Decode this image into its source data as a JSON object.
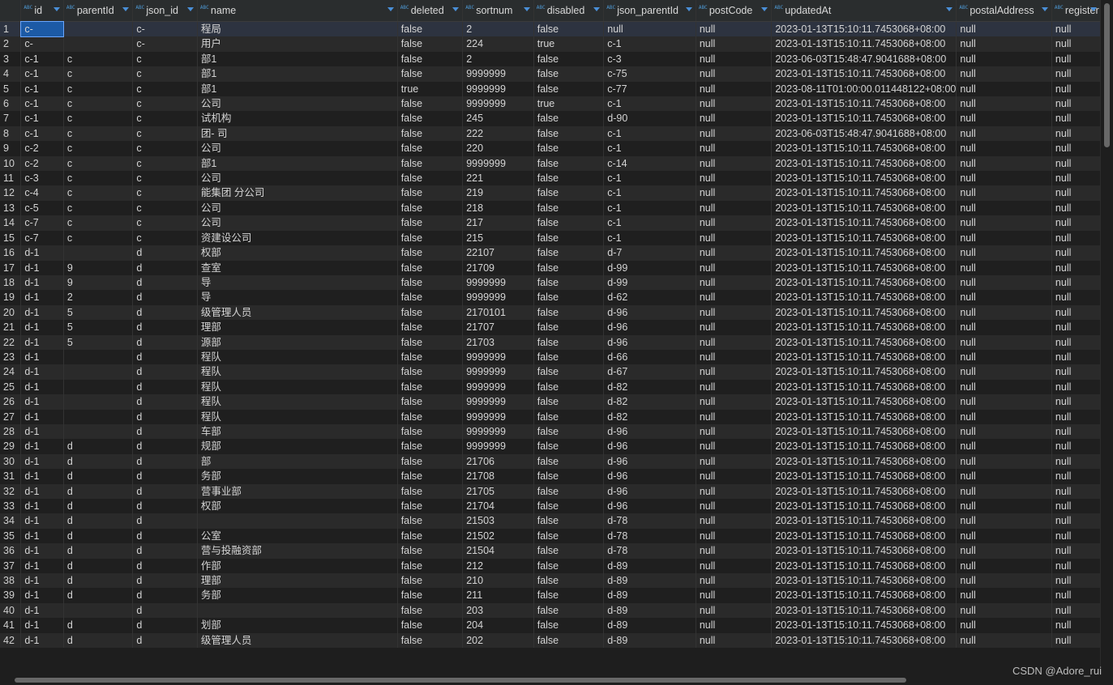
{
  "columns": [
    {
      "label": "id",
      "width": 53
    },
    {
      "label": "parentId",
      "width": 86
    },
    {
      "label": "json_id",
      "width": 80
    },
    {
      "label": "name",
      "width": 250
    },
    {
      "label": "deleted",
      "width": 81
    },
    {
      "label": "sortnum",
      "width": 88
    },
    {
      "label": "disabled",
      "width": 87
    },
    {
      "label": "json_parentId",
      "width": 114
    },
    {
      "label": "postCode",
      "width": 94
    },
    {
      "label": "updatedAt",
      "width": 222
    },
    {
      "label": "postalAddress",
      "width": 118
    },
    {
      "label": "register",
      "width": 60
    }
  ],
  "type_code_label": "ABC",
  "rows": [
    [
      "1",
      "c-",
      "",
      "c-",
      "程局",
      "false",
      "2",
      "false",
      "null",
      "null",
      "2023-01-13T15:10:11.7453068+08:00",
      "null",
      "null"
    ],
    [
      "2",
      "c-",
      "",
      "c-",
      "用户",
      "false",
      "224",
      "true",
      "c-1",
      "null",
      "2023-01-13T15:10:11.7453068+08:00",
      "null",
      "null"
    ],
    [
      "3",
      "c-1",
      "c",
      "c",
      "部1",
      "false",
      "2",
      "false",
      "c-3",
      "null",
      "2023-06-03T15:48:47.9041688+08:00",
      "null",
      "null"
    ],
    [
      "4",
      "c-1",
      "c",
      "c",
      "部1",
      "false",
      "9999999",
      "false",
      "c-75",
      "null",
      "2023-01-13T15:10:11.7453068+08:00",
      "null",
      "null"
    ],
    [
      "5",
      "c-1",
      "c",
      "c",
      "部1",
      "true",
      "9999999",
      "false",
      "c-77",
      "null",
      "2023-08-11T01:00:00.011448122+08:00",
      "null",
      "null"
    ],
    [
      "6",
      "c-1",
      "c",
      "c",
      "公司",
      "false",
      "9999999",
      "true",
      "c-1",
      "null",
      "2023-01-13T15:10:11.7453068+08:00",
      "null",
      "null"
    ],
    [
      "7",
      "c-1",
      "c",
      "c",
      "试机构",
      "false",
      "245",
      "false",
      "d-90",
      "null",
      "2023-01-13T15:10:11.7453068+08:00",
      "null",
      "null"
    ],
    [
      "8",
      "c-1",
      "c",
      "c",
      "团-                  司",
      "false",
      "222",
      "false",
      "c-1",
      "null",
      "2023-06-03T15:48:47.9041688+08:00",
      "null",
      "null"
    ],
    [
      "9",
      "c-2",
      "c",
      "c",
      "公司",
      "false",
      "220",
      "false",
      "c-1",
      "null",
      "2023-01-13T15:10:11.7453068+08:00",
      "null",
      "null"
    ],
    [
      "10",
      "c-2",
      "c",
      "c",
      "部1",
      "false",
      "9999999",
      "false",
      "c-14",
      "null",
      "2023-01-13T15:10:11.7453068+08:00",
      "null",
      "null"
    ],
    [
      "11",
      "c-3",
      "c",
      "c",
      "公司",
      "false",
      "221",
      "false",
      "c-1",
      "null",
      "2023-01-13T15:10:11.7453068+08:00",
      "null",
      "null"
    ],
    [
      "12",
      "c-4",
      "c",
      "c",
      "能集团                  分公司",
      "false",
      "219",
      "false",
      "c-1",
      "null",
      "2023-01-13T15:10:11.7453068+08:00",
      "null",
      "null"
    ],
    [
      "13",
      "c-5",
      "c",
      "c",
      "公司",
      "false",
      "218",
      "false",
      "c-1",
      "null",
      "2023-01-13T15:10:11.7453068+08:00",
      "null",
      "null"
    ],
    [
      "14",
      "c-7",
      "c",
      "c",
      "公司",
      "false",
      "217",
      "false",
      "c-1",
      "null",
      "2023-01-13T15:10:11.7453068+08:00",
      "null",
      "null"
    ],
    [
      "15",
      "c-7",
      "c",
      "c",
      "资建设公司",
      "false",
      "215",
      "false",
      "c-1",
      "null",
      "2023-01-13T15:10:11.7453068+08:00",
      "null",
      "null"
    ],
    [
      "16",
      "d-1",
      "",
      "d",
      "权部",
      "false",
      "22107",
      "false",
      "d-7",
      "null",
      "2023-01-13T15:10:11.7453068+08:00",
      "null",
      "null"
    ],
    [
      "17",
      "d-1",
      "9",
      "d",
      "查室",
      "false",
      "21709",
      "false",
      "d-99",
      "null",
      "2023-01-13T15:10:11.7453068+08:00",
      "null",
      "null"
    ],
    [
      "18",
      "d-1",
      "9",
      "d",
      "导",
      "false",
      "9999999",
      "false",
      "d-99",
      "null",
      "2023-01-13T15:10:11.7453068+08:00",
      "null",
      "null"
    ],
    [
      "19",
      "d-1",
      "2",
      "d",
      "导",
      "false",
      "9999999",
      "false",
      "d-62",
      "null",
      "2023-01-13T15:10:11.7453068+08:00",
      "null",
      "null"
    ],
    [
      "20",
      "d-1",
      "5",
      "d",
      "级管理人员",
      "false",
      "2170101",
      "false",
      "d-96",
      "null",
      "2023-01-13T15:10:11.7453068+08:00",
      "null",
      "null"
    ],
    [
      "21",
      "d-1",
      "5",
      "d",
      "理部",
      "false",
      "21707",
      "false",
      "d-96",
      "null",
      "2023-01-13T15:10:11.7453068+08:00",
      "null",
      "null"
    ],
    [
      "22",
      "d-1",
      "5",
      "d",
      "源部",
      "false",
      "21703",
      "false",
      "d-96",
      "null",
      "2023-01-13T15:10:11.7453068+08:00",
      "null",
      "null"
    ],
    [
      "23",
      "d-1",
      "",
      "d",
      "程队",
      "false",
      "9999999",
      "false",
      "d-66",
      "null",
      "2023-01-13T15:10:11.7453068+08:00",
      "null",
      "null"
    ],
    [
      "24",
      "d-1",
      "",
      "d",
      "程队",
      "false",
      "9999999",
      "false",
      "d-67",
      "null",
      "2023-01-13T15:10:11.7453068+08:00",
      "null",
      "null"
    ],
    [
      "25",
      "d-1",
      "",
      "d",
      "程队",
      "false",
      "9999999",
      "false",
      "d-82",
      "null",
      "2023-01-13T15:10:11.7453068+08:00",
      "null",
      "null"
    ],
    [
      "26",
      "d-1",
      "",
      "d",
      "程队",
      "false",
      "9999999",
      "false",
      "d-82",
      "null",
      "2023-01-13T15:10:11.7453068+08:00",
      "null",
      "null"
    ],
    [
      "27",
      "d-1",
      "",
      "d",
      "程队",
      "false",
      "9999999",
      "false",
      "d-82",
      "null",
      "2023-01-13T15:10:11.7453068+08:00",
      "null",
      "null"
    ],
    [
      "28",
      "d-1",
      "",
      "d",
      "车部",
      "false",
      "9999999",
      "false",
      "d-96",
      "null",
      "2023-01-13T15:10:11.7453068+08:00",
      "null",
      "null"
    ],
    [
      "29",
      "d-1",
      "d",
      "d",
      "规部",
      "false",
      "9999999",
      "false",
      "d-96",
      "null",
      "2023-01-13T15:10:11.7453068+08:00",
      "null",
      "null"
    ],
    [
      "30",
      "d-1",
      "d",
      "d",
      "部",
      "false",
      "21706",
      "false",
      "d-96",
      "null",
      "2023-01-13T15:10:11.7453068+08:00",
      "null",
      "null"
    ],
    [
      "31",
      "d-1",
      "d",
      "d",
      "务部",
      "false",
      "21708",
      "false",
      "d-96",
      "null",
      "2023-01-13T15:10:11.7453068+08:00",
      "null",
      "null"
    ],
    [
      "32",
      "d-1",
      "d",
      "d",
      "营事业部",
      "false",
      "21705",
      "false",
      "d-96",
      "null",
      "2023-01-13T15:10:11.7453068+08:00",
      "null",
      "null"
    ],
    [
      "33",
      "d-1",
      "d",
      "d",
      "权部",
      "false",
      "21704",
      "false",
      "d-96",
      "null",
      "2023-01-13T15:10:11.7453068+08:00",
      "null",
      "null"
    ],
    [
      "34",
      "d-1",
      "d",
      "d",
      "",
      "false",
      "21503",
      "false",
      "d-78",
      "null",
      "2023-01-13T15:10:11.7453068+08:00",
      "null",
      "null"
    ],
    [
      "35",
      "d-1",
      "d",
      "d",
      "公室",
      "false",
      "21502",
      "false",
      "d-78",
      "null",
      "2023-01-13T15:10:11.7453068+08:00",
      "null",
      "null"
    ],
    [
      "36",
      "d-1",
      "d",
      "d",
      "营与投融资部",
      "false",
      "21504",
      "false",
      "d-78",
      "null",
      "2023-01-13T15:10:11.7453068+08:00",
      "null",
      "null"
    ],
    [
      "37",
      "d-1",
      "d",
      "d",
      "作部",
      "false",
      "212",
      "false",
      "d-89",
      "null",
      "2023-01-13T15:10:11.7453068+08:00",
      "null",
      "null"
    ],
    [
      "38",
      "d-1",
      "d",
      "d",
      "理部",
      "false",
      "210",
      "false",
      "d-89",
      "null",
      "2023-01-13T15:10:11.7453068+08:00",
      "null",
      "null"
    ],
    [
      "39",
      "d-1",
      "d",
      "d",
      "务部",
      "false",
      "211",
      "false",
      "d-89",
      "null",
      "2023-01-13T15:10:11.7453068+08:00",
      "null",
      "null"
    ],
    [
      "40",
      "d-1",
      "",
      "d",
      "",
      "false",
      "203",
      "false",
      "d-89",
      "null",
      "2023-01-13T15:10:11.7453068+08:00",
      "null",
      "null"
    ],
    [
      "41",
      "d-1",
      "d",
      "d",
      "划部",
      "false",
      "204",
      "false",
      "d-89",
      "null",
      "2023-01-13T15:10:11.7453068+08:00",
      "null",
      "null"
    ],
    [
      "42",
      "d-1",
      "d",
      "d",
      "级管理人员",
      "false",
      "202",
      "false",
      "d-89",
      "null",
      "2023-01-13T15:10:11.7453068+08:00",
      "null",
      "null"
    ]
  ],
  "watermark": "CSDN @Adore_rui"
}
